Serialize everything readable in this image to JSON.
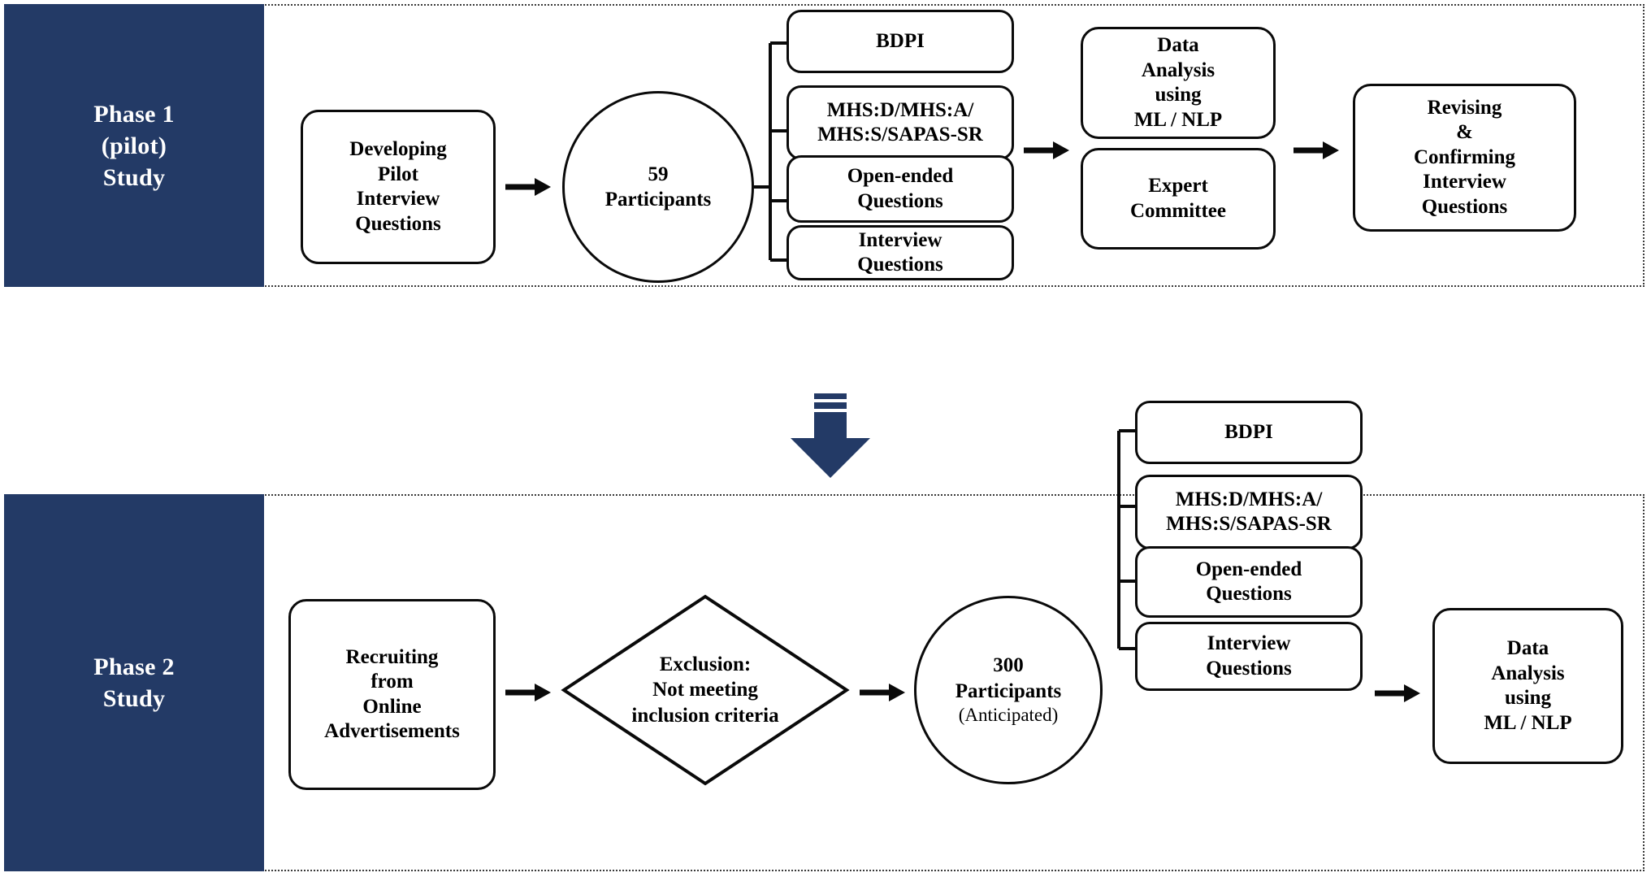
{
  "diagram": {
    "title": "Two-phase study flow diagram",
    "colors": {
      "navy": "#233A66",
      "stroke": "#0A0A0A",
      "band_border": "#3A3A3A"
    }
  },
  "phase1": {
    "label": "Phase 1\n(pilot)\nStudy",
    "label_lines": [
      "Phase 1",
      "(pilot)",
      "Study"
    ],
    "steps": {
      "develop": "Developing\nPilot\nInterview\nQuestions",
      "develop_lines": [
        "Developing",
        "Pilot",
        "Interview",
        "Questions"
      ],
      "participants_count": "59",
      "participants_word": "Participants",
      "instruments": [
        {
          "name": "bdpi",
          "label": "BDPI"
        },
        {
          "name": "mhs",
          "label": "MHS:D/MHS:A/\nMHS:S/SAPAS-SR",
          "lines": [
            "MHS:D/MHS:A/",
            "MHS:S/SAPAS-SR"
          ]
        },
        {
          "name": "open-ended",
          "label": "Open-ended\nQuestions",
          "lines": [
            "Open-ended",
            "Questions"
          ]
        },
        {
          "name": "interview",
          "label": "Interview\nQuestions",
          "lines": [
            "Interview",
            "Questions"
          ]
        }
      ],
      "analysis": "Data\nAnalysis\nusing\nML / NLP",
      "analysis_lines": [
        "Data",
        "Analysis",
        "using",
        "ML / NLP"
      ],
      "expert": "Expert\nCommittee",
      "expert_lines": [
        "Expert",
        "Committee"
      ],
      "revising": "Revising\n&\nConfirming\nInterview\nQuestions",
      "revising_lines": [
        "Revising",
        "&",
        "Confirming",
        "Interview",
        "Questions"
      ]
    }
  },
  "phase2": {
    "label": "Phase 2\nStudy",
    "label_lines": [
      "Phase 2",
      "Study"
    ],
    "steps": {
      "recruiting": "Recruiting\nfrom\nOnline\nAdvertisements",
      "recruiting_lines": [
        "Recruiting",
        "from",
        "Online",
        "Advertisements"
      ],
      "exclusion": "Exclusion:\nNot meeting\ninclusion criteria",
      "exclusion_lines": [
        "Exclusion:",
        "Not meeting",
        "inclusion criteria"
      ],
      "participants_count": "300",
      "participants_word": "Participants",
      "participants_note": "(Anticipated)",
      "instruments": [
        {
          "name": "bdpi",
          "label": "BDPI"
        },
        {
          "name": "mhs",
          "label": "MHS:D/MHS:A/\nMHS:S/SAPAS-SR",
          "lines": [
            "MHS:D/MHS:A/",
            "MHS:S/SAPAS-SR"
          ]
        },
        {
          "name": "open-ended",
          "label": "Open-ended\nQuestions",
          "lines": [
            "Open-ended",
            "Questions"
          ]
        },
        {
          "name": "interview",
          "label": "Interview\nQuestions",
          "lines": [
            "Interview",
            "Questions"
          ]
        }
      ],
      "analysis": "Data\nAnalysis\nusing\nML / NLP",
      "analysis_lines": [
        "Data",
        "Analysis",
        "using",
        "ML / NLP"
      ]
    }
  },
  "transition": {
    "icon": "down-arrow-icon",
    "color": "#233A66"
  }
}
